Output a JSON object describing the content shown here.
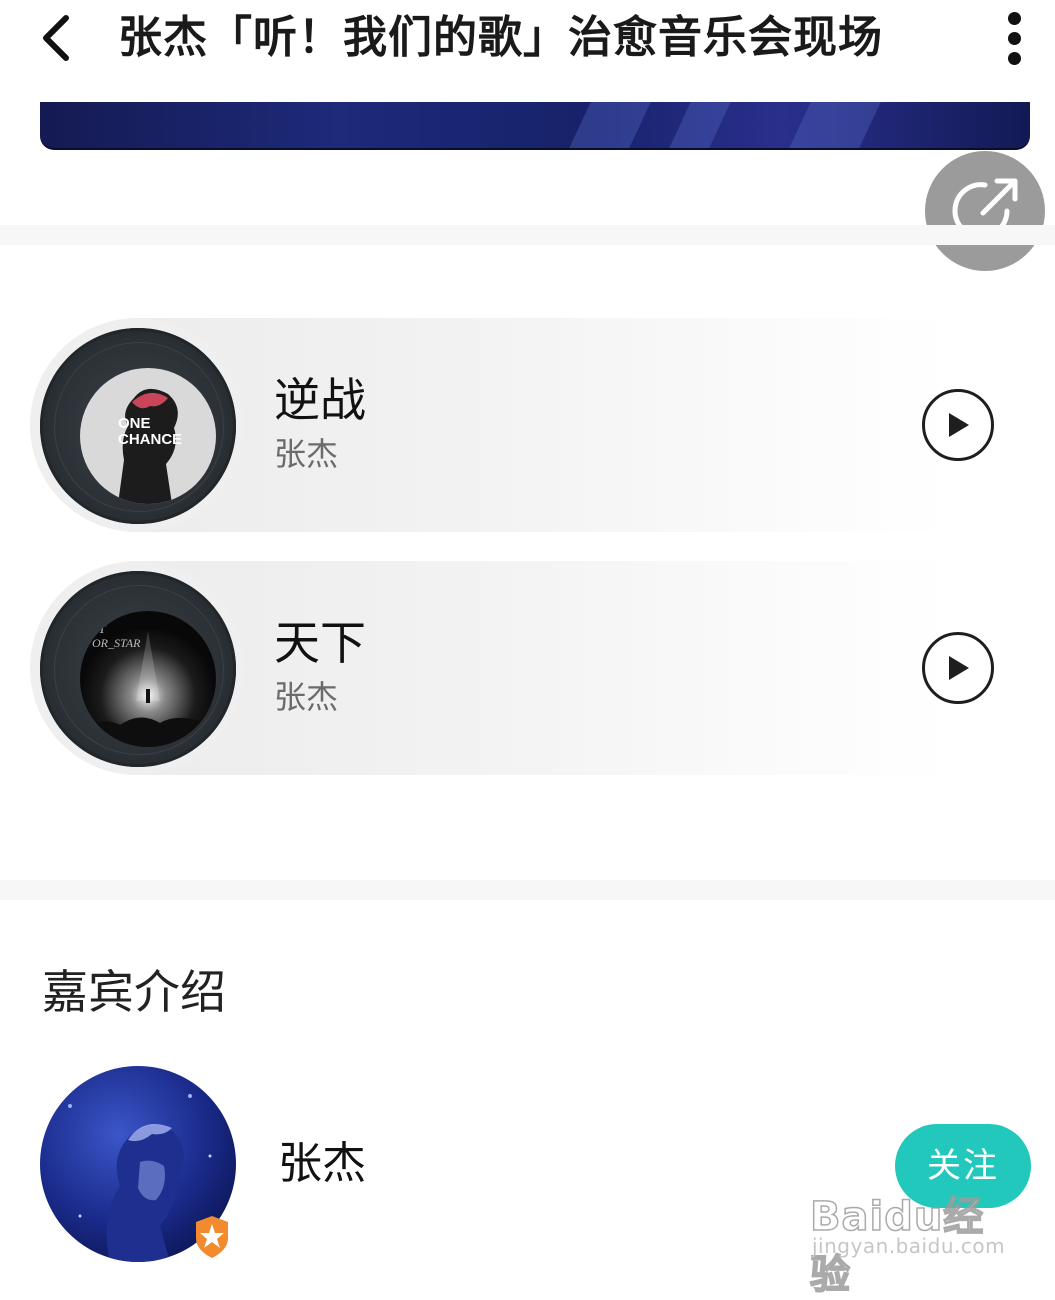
{
  "header": {
    "title": "张杰「听！我们的歌」治愈音乐会现场"
  },
  "songs": [
    {
      "title": "逆战",
      "artist": "张杰",
      "cover_text": [
        "ONE",
        "CHANCE"
      ]
    },
    {
      "title": "天下",
      "artist": "张杰",
      "cover_text": [
        "ST",
        "OR_STAR"
      ]
    }
  ],
  "guests": {
    "section_title": "嘉宾介绍",
    "items": [
      {
        "name": "张杰",
        "follow_label": "关注"
      }
    ]
  },
  "watermark": {
    "logo": "Baidu经验",
    "url": "jingyan.baidu.com"
  },
  "colors": {
    "accent": "#23c8bd",
    "banner": "#1e2a7a",
    "share_button": "#9b9b9b",
    "badge": "#f28a2e"
  }
}
